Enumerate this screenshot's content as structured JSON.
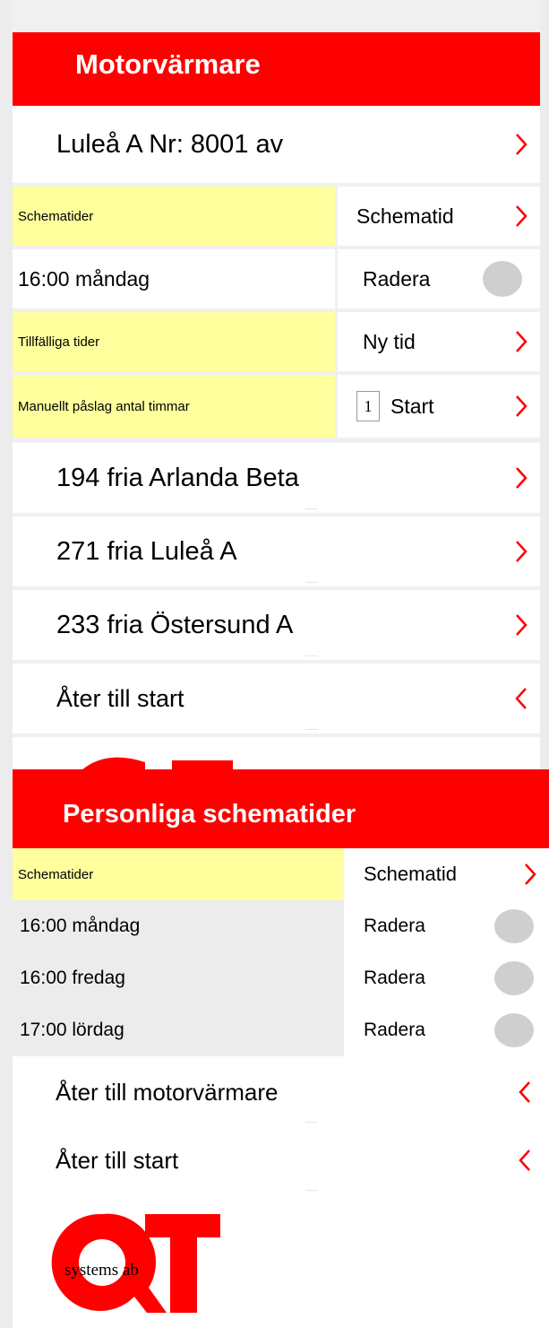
{
  "motor": {
    "title": "Motorvärmare",
    "device": "Luleå A Nr: 8001  av",
    "schedule_label": "Schematider",
    "schedule_button": "Schematid",
    "time_entry": "16:00 måndag",
    "delete_label": "Radera",
    "temp_label": "Tillfälliga tider",
    "new_time_button": "Ny tid",
    "manual_label": "Manuellt påslag antal timmar",
    "hours_value": "1",
    "start_button": "Start",
    "locations": [
      "194 fria Arlanda Beta",
      "271 fria Luleå A",
      "233 fria Östersund A"
    ],
    "back_start": "Åter till start"
  },
  "personal": {
    "title": "Personliga schematider",
    "schedule_label": "Schematider",
    "schedule_button": "Schematid",
    "entries": [
      {
        "time": "16:00 måndag",
        "action": "Radera"
      },
      {
        "time": "16:00 fredag",
        "action": "Radera"
      },
      {
        "time": "17:00 lördag",
        "action": "Radera"
      }
    ],
    "back_motor": "Åter till motorvärmare",
    "back_start": "Åter till start"
  },
  "logo": {
    "text": "systems ab",
    "brand": "QT"
  },
  "colors": {
    "header": "#ff0000",
    "highlight": "#ffff9e",
    "chevron": "#ff0000",
    "toggle": "#cfcfcf"
  },
  "icons": {
    "forward": "chevron-right-icon",
    "back": "chevron-left-icon",
    "toggle": "toggle-icon"
  }
}
